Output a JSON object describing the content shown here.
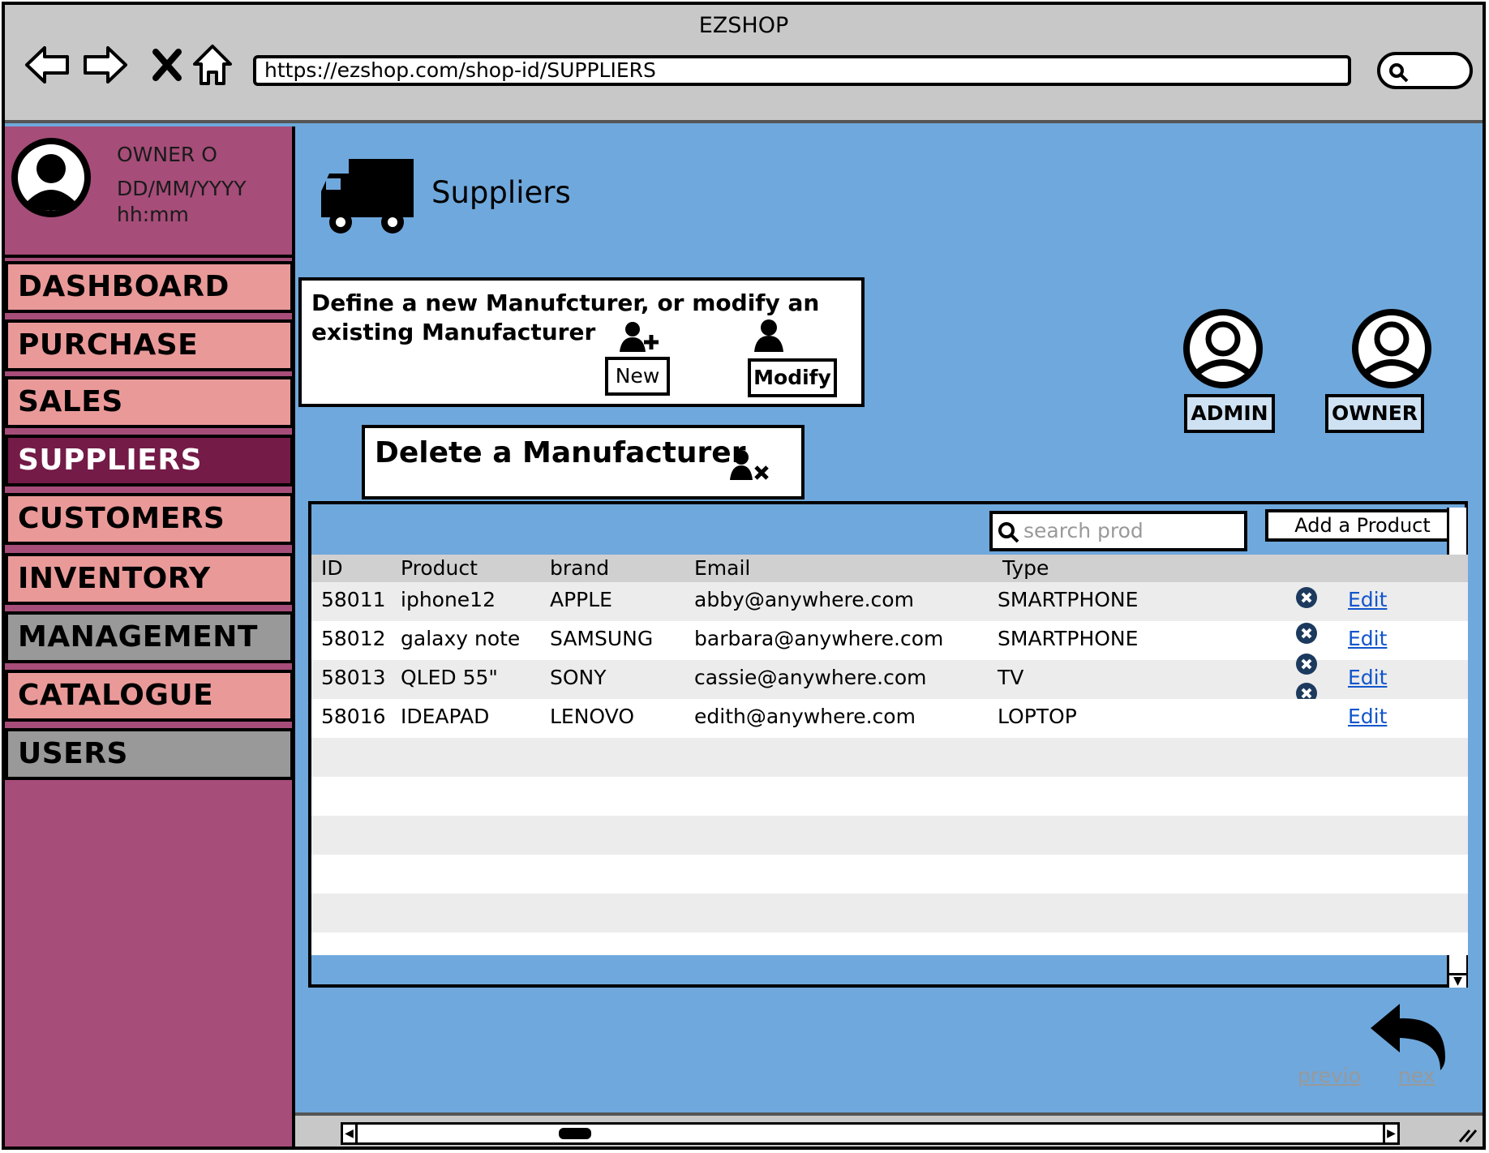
{
  "browser": {
    "title": "EZSHOP",
    "url": "https://ezshop.com/shop-id/SUPPLIERS"
  },
  "profile": {
    "name": "OWNER O",
    "date": "DD/MM/YYYY",
    "time": "hh:mm"
  },
  "sidebar": {
    "items": [
      {
        "label": "DASHBOARD"
      },
      {
        "label": "PURCHASE"
      },
      {
        "label": "SALES"
      },
      {
        "label": "SUPPLIERS"
      },
      {
        "label": "CUSTOMERS"
      },
      {
        "label": "INVENTORY"
      },
      {
        "label": "MANAGEMENT"
      },
      {
        "label": "CATALOGUE"
      },
      {
        "label": "USERS"
      }
    ],
    "active": "SUPPLIERS"
  },
  "page": {
    "title": "Suppliers"
  },
  "define_panel": {
    "text": "Define a new Manufcturer, or modify an existing Manufacturer",
    "new_label": "New",
    "modify_label": "Modify"
  },
  "delete_panel": {
    "text": "Delete a Manufacturer"
  },
  "roles": {
    "admin_label": "ADMIN",
    "owner_label": "OWNER"
  },
  "table": {
    "search_placeholder": "search prod",
    "add_button": "Add a Product",
    "columns": [
      "ID",
      "Product",
      "brand",
      "Email",
      "Type"
    ],
    "rows": [
      {
        "id": "58011",
        "product": "iphone12",
        "brand": "APPLE",
        "email": "abby@anywhere.com",
        "type": "SMARTPHONE",
        "edit": "Edit"
      },
      {
        "id": "58012",
        "product": "galaxy note",
        "brand": "SAMSUNG",
        "email": "barbara@anywhere.com",
        "type": "SMARTPHONE",
        "edit": "Edit"
      },
      {
        "id": "58013",
        "product": "QLED 55\"",
        "brand": "SONY",
        "email": "cassie@anywhere.com",
        "type": "TV",
        "edit": "Edit"
      },
      {
        "id": "58016",
        "product": "IDEAPAD",
        "brand": "LENOVO",
        "email": "edith@anywhere.com",
        "type": "LOPTOP",
        "edit": "Edit"
      }
    ]
  },
  "pager": {
    "prev": "previo",
    "next": "nex"
  },
  "colors": {
    "main_bg": "#6fa8dc",
    "sidebar_bg": "#a64d79",
    "nav_item": "#ea9999",
    "nav_active": "#741b47",
    "nav_gray": "#999999",
    "link": "#1155cc"
  },
  "icons": [
    "back-arrow-icon",
    "forward-arrow-icon",
    "close-icon",
    "home-icon",
    "search-icon",
    "user-icon",
    "truck-icon",
    "user-add-icon",
    "user-edit-icon",
    "user-remove-icon",
    "delete-circle-icon",
    "undo-arrow-icon"
  ]
}
